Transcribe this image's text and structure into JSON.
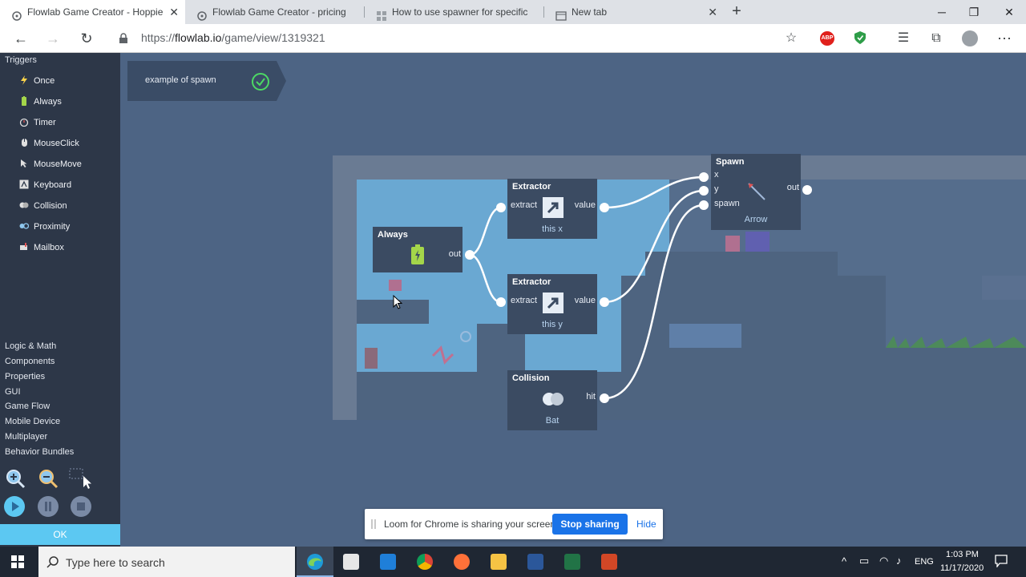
{
  "browser": {
    "tabs": [
      {
        "title": "Flowlab Game Creator - Hoppie",
        "active": true
      },
      {
        "title": "Flowlab Game Creator - pricing",
        "active": false
      },
      {
        "title": "How to use spawner for specific",
        "active": false
      },
      {
        "title": "New tab",
        "active": false
      }
    ],
    "url_prefix": "https://",
    "url_host": "flowlab.io",
    "url_path": "/game/view/1319321",
    "extensions": {
      "abp": "ABP"
    }
  },
  "sidebar": {
    "triggers_heading": "Triggers",
    "triggers": [
      {
        "label": "Once",
        "icon": "lightning-icon",
        "color": "#ffd54a"
      },
      {
        "label": "Always",
        "icon": "battery-icon",
        "color": "#a4d64a"
      },
      {
        "label": "Timer",
        "icon": "timer-icon",
        "color": "#e0e0e0"
      },
      {
        "label": "MouseClick",
        "icon": "mouse-icon",
        "color": "#e0e0e0"
      },
      {
        "label": "MouseMove",
        "icon": "cursor-icon",
        "color": "#e0e0e0"
      },
      {
        "label": "Keyboard",
        "icon": "keyboard-icon",
        "color": "#e0e0e0"
      },
      {
        "label": "Collision",
        "icon": "collision-icon",
        "color": "#e0e0e0"
      },
      {
        "label": "Proximity",
        "icon": "proximity-icon",
        "color": "#8fc7ee"
      },
      {
        "label": "Mailbox",
        "icon": "mailbox-icon",
        "color": "#e05555"
      }
    ],
    "categories": [
      "Logic & Math",
      "Components",
      "Properties",
      "GUI",
      "Game Flow",
      "Mobile Device",
      "Multiplayer",
      "Behavior Bundles"
    ],
    "ok_label": "OK"
  },
  "behavior": {
    "name": "example of spawn"
  },
  "nodes": {
    "always": {
      "title": "Always",
      "out": "out"
    },
    "extractor_x": {
      "title": "Extractor",
      "in": "extract",
      "out": "value",
      "sub": "this x"
    },
    "extractor_y": {
      "title": "Extractor",
      "in": "extract",
      "out": "value",
      "sub": "this y"
    },
    "collision": {
      "title": "Collision",
      "out": "hit",
      "sub": "Bat"
    },
    "spawn": {
      "title": "Spawn",
      "in_x": "x",
      "in_y": "y",
      "in_spawn": "spawn",
      "out": "out",
      "sub": "Arrow"
    }
  },
  "loom": {
    "message": "Loom for Chrome is sharing your screen.",
    "stop_label": "Stop sharing",
    "hide_label": "Hide"
  },
  "taskbar": {
    "search_placeholder": "Type here to search",
    "lang": "ENG",
    "time": "1:03 PM",
    "date": "11/17/2020"
  },
  "colors": {
    "accent": "#1a73e8",
    "sidebar": "#2d3748",
    "node": "#3b4b62",
    "ok": "#5cc8f2",
    "canvas": "#4d6484"
  }
}
